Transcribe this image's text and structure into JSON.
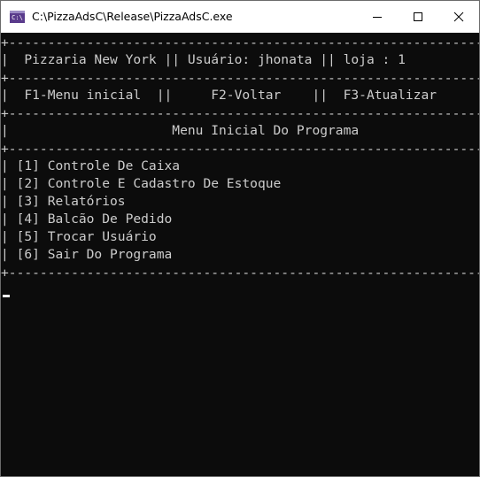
{
  "window": {
    "title": "C:\\PizzaAdsC\\Release\\PizzaAdsC.exe",
    "icon": "console-app-icon",
    "icon_text": "C:\\"
  },
  "console": {
    "rule": "+-------------------------------------------------------------------------+",
    "header_info": "|  Pizzaria New York || Usuário: jhonata || loja : 1                        |",
    "shortcuts": "|  F1-Menu inicial  ||     F2-Voltar    ||  F3-Atualizar                  |",
    "screen_title": "|                     Menu Inicial Do Programa                            |",
    "menu_items": [
      "| [1] Controle De Caixa                                                    |",
      "| [2] Controle E Cadastro De Estoque                                       |",
      "| [3] Relatórios                                                           |",
      "| [4] Balcão De Pedido                                                     |",
      "| [5] Trocar Usuário                                                       |",
      "| [6] Sair Do Programa                                                     |"
    ]
  },
  "colors": {
    "background": "#0c0c0c",
    "text": "#cccccc",
    "titlebar": "#ffffff"
  }
}
